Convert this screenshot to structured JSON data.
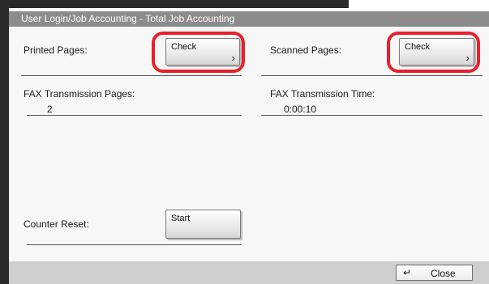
{
  "window": {
    "title": "User Login/Job Accounting - Total Job Accounting"
  },
  "fields": {
    "printed_pages": {
      "label": "Printed Pages:",
      "button_label": "Check"
    },
    "scanned_pages": {
      "label": "Scanned Pages:",
      "button_label": "Check"
    },
    "fax_pages": {
      "label": "FAX Transmission Pages:",
      "value": "2"
    },
    "fax_time": {
      "label": "FAX Transmission Time:",
      "value": "0:00:10"
    },
    "counter_reset": {
      "label": "Counter Reset:",
      "button_label": "Start"
    }
  },
  "footer": {
    "close_label": "Close"
  },
  "icons": {
    "chevron": "chevron-right-icon",
    "enter": "enter-return-icon"
  },
  "colors": {
    "highlight": "#e8202a",
    "titlebar": "#8c8c8c"
  }
}
